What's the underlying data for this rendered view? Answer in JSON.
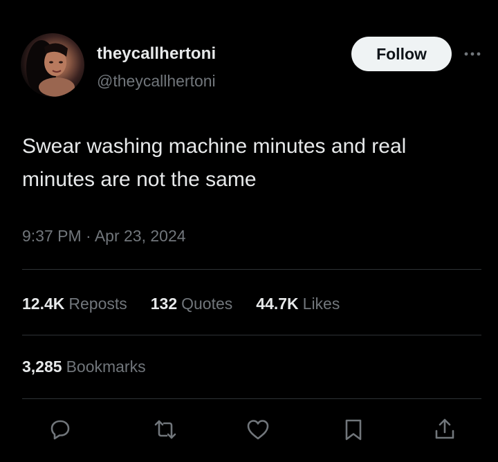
{
  "user": {
    "display_name": "theycallhertoni",
    "handle": "@theycallhertoni",
    "follow_label": "Follow"
  },
  "tweet": {
    "text": "Swear washing machine minutes and real minutes are not the same",
    "timestamp": "9:37 PM · Apr 23, 2024"
  },
  "stats": {
    "reposts": {
      "count": "12.4K",
      "label": "Reposts"
    },
    "quotes": {
      "count": "132",
      "label": "Quotes"
    },
    "likes": {
      "count": "44.7K",
      "label": "Likes"
    },
    "bookmarks": {
      "count": "3,285",
      "label": "Bookmarks"
    }
  },
  "icons": {
    "more": "more-horizontal-icon",
    "reply": "reply-icon",
    "repost": "repost-icon",
    "like": "heart-icon",
    "bookmark": "bookmark-icon",
    "share": "share-icon"
  },
  "colors": {
    "background": "#000000",
    "primary_text": "#e7e9ea",
    "secondary_text": "#71767b",
    "divider": "#2f3336",
    "follow_bg": "#eff3f4"
  }
}
